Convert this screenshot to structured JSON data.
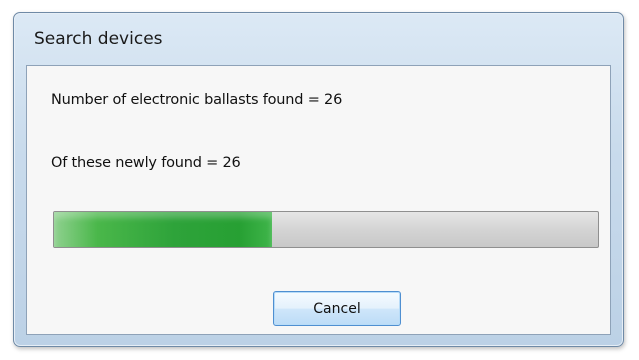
{
  "window": {
    "title": "Search devices"
  },
  "status": {
    "ballasts_found_text": "Number of electronic ballasts found = 26",
    "newly_found_text": "Of these newly found  = 26"
  },
  "progress": {
    "value_fraction": 0.4
  },
  "buttons": {
    "cancel_label": "Cancel"
  }
}
